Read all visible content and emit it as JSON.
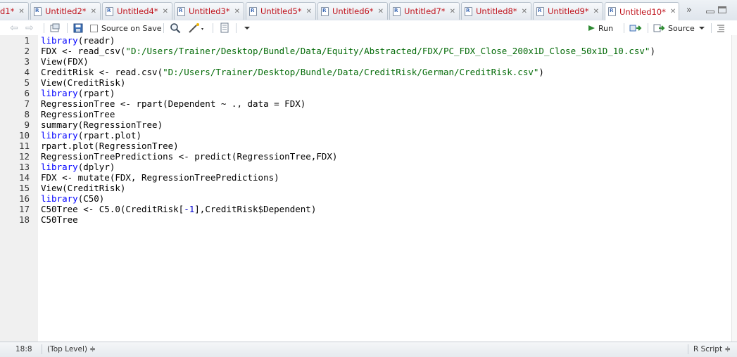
{
  "tabs": [
    {
      "label": "d1*",
      "active": false
    },
    {
      "label": "Untitled2*",
      "active": false
    },
    {
      "label": "Untitled4*",
      "active": false
    },
    {
      "label": "Untitled3*",
      "active": false
    },
    {
      "label": "Untitled5*",
      "active": false
    },
    {
      "label": "Untitled6*",
      "active": false
    },
    {
      "label": "Untitled7*",
      "active": false
    },
    {
      "label": "Untitled8*",
      "active": false
    },
    {
      "label": "Untitled9*",
      "active": false
    },
    {
      "label": "Untitled10*",
      "active": true
    }
  ],
  "toolbar": {
    "source_on_save": "Source on Save",
    "run": "Run",
    "source": "Source"
  },
  "code_lines": [
    "1",
    "2",
    "3",
    "4",
    "5",
    "6",
    "7",
    "8",
    "9",
    "10",
    "11",
    "12",
    "13",
    "14",
    "15",
    "16",
    "17",
    "18"
  ],
  "code": {
    "l1_kw": "library",
    "l1_rest": "(readr)",
    "l2_a": "FDX <- read_csv(",
    "l2_str": "\"D:/Users/Trainer/Desktop/Bundle/Data/Equity/Abstracted/FDX/PC_FDX_Close_200x1D_Close_50x1D_10.csv\"",
    "l2_b": ")",
    "l3": "View(FDX)",
    "l4_a": "CreditRisk <- read.csv(",
    "l4_str": "\"D:/Users/Trainer/Desktop/Bundle/Data/CreditRisk/German/CreditRisk.csv\"",
    "l4_b": ")",
    "l5": "View(CreditRisk)",
    "l6_kw": "library",
    "l6_rest": "(rpart)",
    "l7": "RegressionTree <- rpart(Dependent ~ ., data = FDX)",
    "l8": "RegressionTree",
    "l9": "summary(RegressionTree)",
    "l10_kw": "library",
    "l10_rest": "(rpart.plot)",
    "l11": "rpart.plot(RegressionTree)",
    "l12": "RegressionTreePredictions <- predict(RegressionTree,FDX)",
    "l13_kw": "library",
    "l13_rest": "(dplyr)",
    "l14": "FDX <- mutate(FDX, RegressionTreePredictions)",
    "l15": "View(CreditRisk)",
    "l16_kw": "library",
    "l16_rest": "(C50)",
    "l17_a": "C50Tree <- C5.0(CreditRisk[",
    "l17_num": "-1",
    "l17_b": "],CreditRisk$Dependent)",
    "l18": "C50Tree"
  },
  "status": {
    "position": "18:8",
    "scope": "(Top Level) ≑",
    "filetype": "R Script ≑"
  },
  "colors": {
    "keyword": "#0000ff",
    "string": "#036a07",
    "tab_text": "#c0141d",
    "run_icon": "#2d8a32"
  }
}
